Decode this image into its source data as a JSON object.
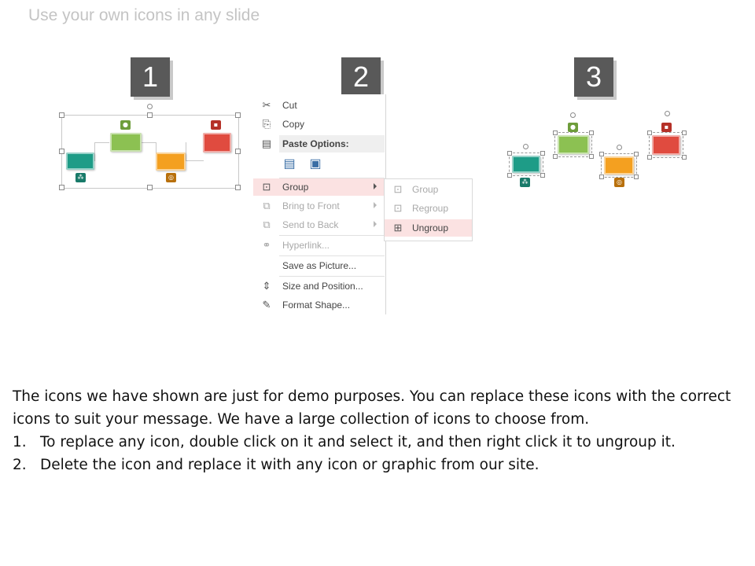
{
  "slide": {
    "title": "Use your own icons in any slide"
  },
  "steps": [
    "1",
    "2",
    "3"
  ],
  "colors": {
    "teal": "#1e9c87",
    "green": "#8cc152",
    "orange": "#f4a020",
    "red": "#e04b3f",
    "badge": "#595959",
    "menu_highlight": "#fbe2e2"
  },
  "context_menu": {
    "items": [
      {
        "label": "Cut",
        "icon": "scissors-icon",
        "glyph": "✂",
        "disabled": false
      },
      {
        "label": "Copy",
        "icon": "copy-icon",
        "glyph": "⎘",
        "disabled": false
      },
      {
        "label": "Paste Options:",
        "icon": "clipboard-icon",
        "glyph": "📋",
        "disabled": false
      },
      {
        "label": "Group",
        "icon": "group-icon",
        "glyph": "⊡",
        "disabled": false,
        "highlight": true,
        "submenu": true
      },
      {
        "label": "Bring to Front",
        "icon": "bring-front-icon",
        "glyph": "⧉",
        "disabled": true,
        "submenu": true
      },
      {
        "label": "Send to Back",
        "icon": "send-back-icon",
        "glyph": "⧉",
        "disabled": true,
        "submenu": true
      },
      {
        "label": "Hyperlink...",
        "icon": "hyperlink-icon",
        "glyph": "🔗",
        "disabled": true
      },
      {
        "label": "Save as Picture...",
        "icon": "",
        "glyph": "",
        "disabled": false
      },
      {
        "label": "Size and Position...",
        "icon": "size-position-icon",
        "glyph": "⇕",
        "disabled": false
      },
      {
        "label": "Format Shape...",
        "icon": "format-shape-icon",
        "glyph": "🖌",
        "disabled": false
      }
    ],
    "paste_buttons": [
      "paste-keep-icon",
      "paste-picture-icon"
    ]
  },
  "submenu": {
    "items": [
      {
        "label": "Group",
        "icon": "group-icon",
        "disabled": true
      },
      {
        "label": "Regroup",
        "icon": "regroup-icon",
        "disabled": true
      },
      {
        "label": "Ungroup",
        "icon": "ungroup-icon",
        "disabled": false,
        "highlight": true
      }
    ]
  },
  "body": {
    "intro": "The icons we have shown are just for demo purposes. You can replace these icons with the correct icons to suit your message. We have a large collection of icons to choose from.",
    "list": [
      {
        "num": "1.",
        "text": "To replace any icon, double click on it and select it, and then right click it to ungroup it."
      },
      {
        "num": "2.",
        "text": "Delete the icon and replace it with any icon or graphic from our site."
      }
    ]
  }
}
